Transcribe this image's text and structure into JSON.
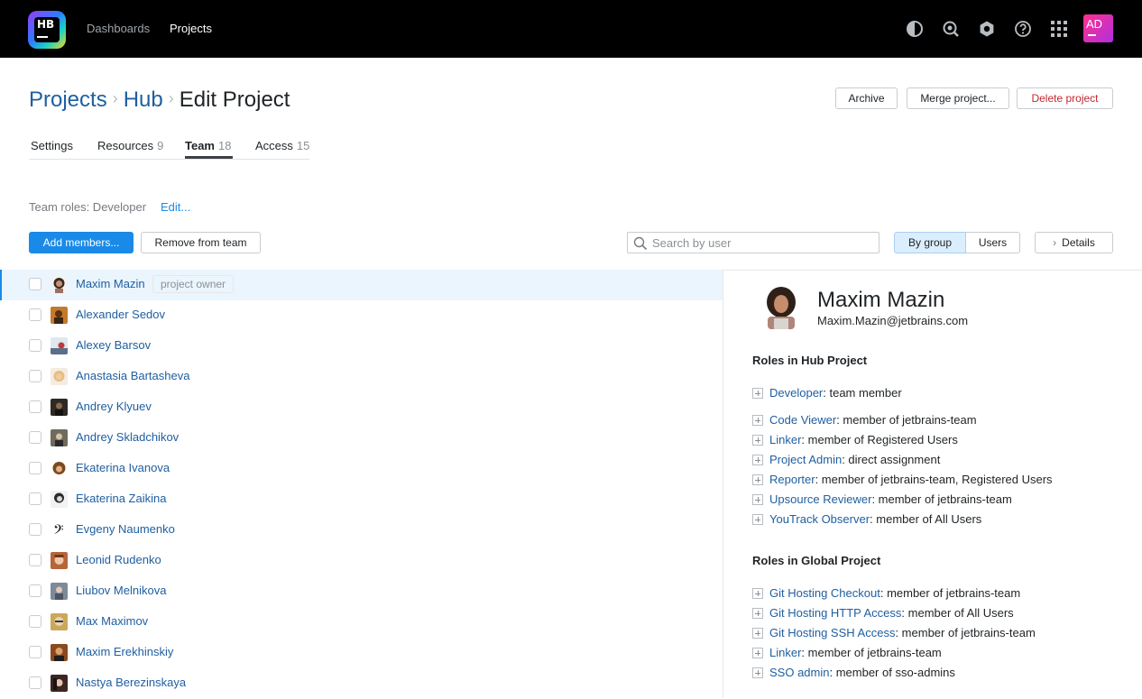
{
  "app": {
    "logo_text": "HB",
    "user_initials": "AD"
  },
  "nav": {
    "dashboards": "Dashboards",
    "projects": "Projects"
  },
  "top_icons": [
    "theme-icon",
    "search-icon",
    "settings-icon",
    "help-icon",
    "apps-grid-icon"
  ],
  "breadcrumb": {
    "projects": "Projects",
    "hub": "Hub",
    "current": "Edit Project"
  },
  "header_buttons": {
    "archive": "Archive",
    "merge": "Merge project...",
    "delete": "Delete project"
  },
  "tabs": [
    {
      "label": "Settings",
      "count": ""
    },
    {
      "label": "Resources",
      "count": "9"
    },
    {
      "label": "Team",
      "count": "18"
    },
    {
      "label": "Access",
      "count": "15"
    }
  ],
  "team_roles": {
    "label": "Team roles: Developer",
    "edit": "Edit..."
  },
  "toolbar": {
    "add_members": "Add members...",
    "remove_from_team": "Remove from team",
    "search_placeholder": "Search by user",
    "by_group": "By group",
    "users": "Users",
    "details": "Details"
  },
  "members": [
    {
      "name": "Maxim Mazin",
      "badge": "project owner",
      "selected": true
    },
    {
      "name": "Alexander Sedov"
    },
    {
      "name": "Alexey Barsov"
    },
    {
      "name": "Anastasia Bartasheva"
    },
    {
      "name": "Andrey Klyuev"
    },
    {
      "name": "Andrey Skladchikov"
    },
    {
      "name": "Ekaterina Ivanova"
    },
    {
      "name": "Ekaterina Zaikina"
    },
    {
      "name": "Evgeny Naumenko"
    },
    {
      "name": "Leonid Rudenko"
    },
    {
      "name": "Liubov Melnikova"
    },
    {
      "name": "Max Maximov"
    },
    {
      "name": "Maxim Erekhinskiy"
    },
    {
      "name": "Nastya Berezinskaya"
    }
  ],
  "details": {
    "name": "Maxim Mazin",
    "email": "Maxim.Mazin@jetbrains.com",
    "hub_section": "Roles in Hub Project",
    "hub_roles": [
      {
        "role": "Developer",
        "desc": ": team member"
      },
      {
        "role": "Code Viewer",
        "desc": ": member of jetbrains-team"
      },
      {
        "role": "Linker",
        "desc": ": member of Registered Users"
      },
      {
        "role": "Project Admin",
        "desc": ": direct assignment"
      },
      {
        "role": "Reporter",
        "desc": ": member of jetbrains-team, Registered Users"
      },
      {
        "role": "Upsource Reviewer",
        "desc": ": member of jetbrains-team"
      },
      {
        "role": "YouTrack Observer",
        "desc": ": member of All Users"
      }
    ],
    "global_section": "Roles in Global Project",
    "global_roles": [
      {
        "role": "Git Hosting Checkout",
        "desc": ": member of jetbrains-team"
      },
      {
        "role": "Git Hosting HTTP Access",
        "desc": ": member of All Users"
      },
      {
        "role": "Git Hosting SSH Access",
        "desc": ": member of jetbrains-team"
      },
      {
        "role": "Linker",
        "desc": ": member of jetbrains-team"
      },
      {
        "role": "SSO admin",
        "desc": ": member of sso-admins"
      }
    ]
  }
}
